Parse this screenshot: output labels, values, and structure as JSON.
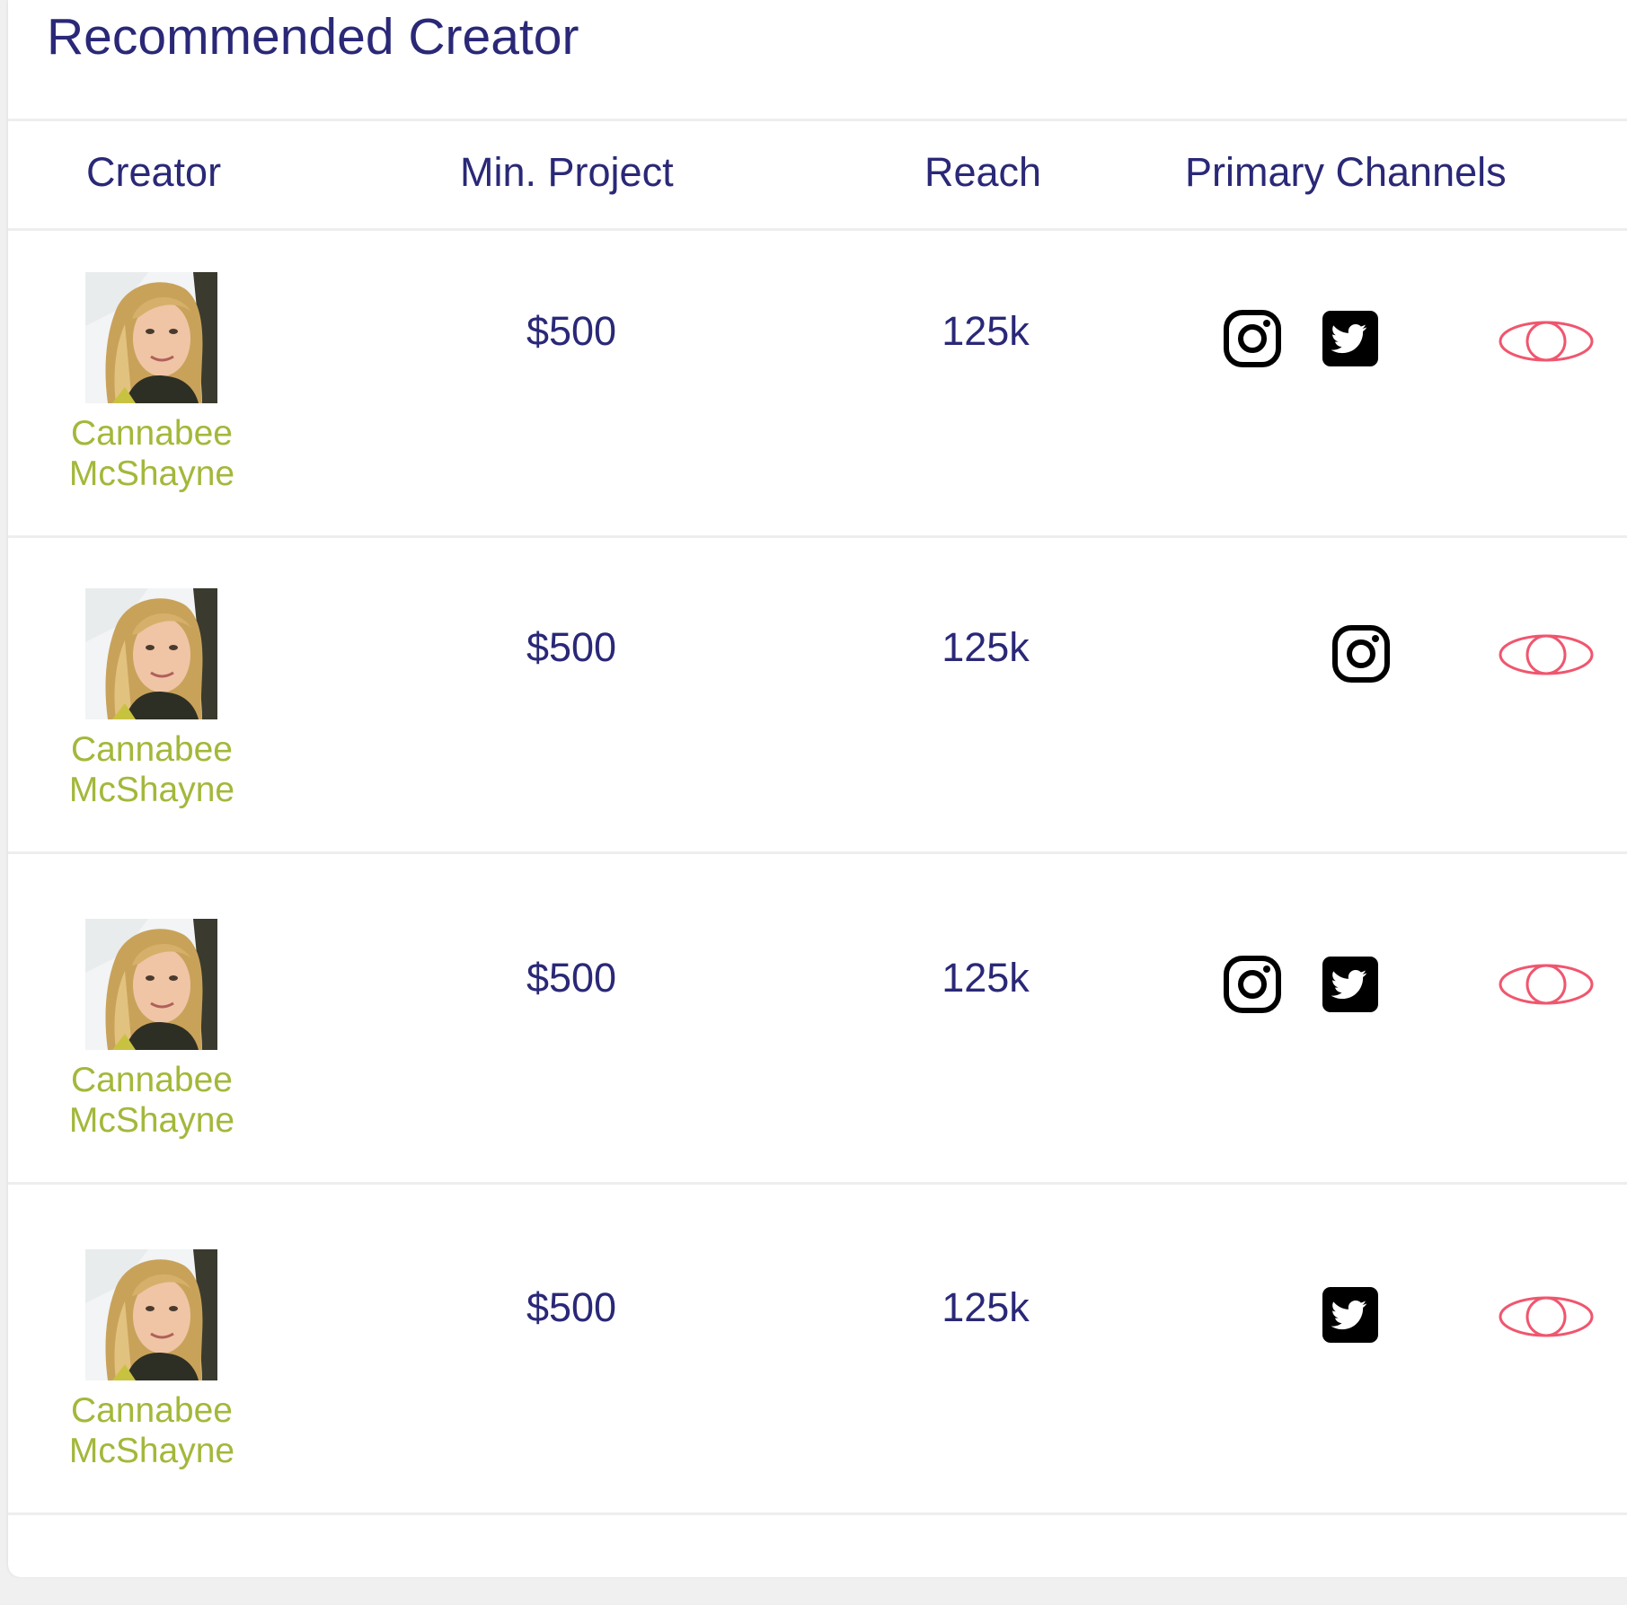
{
  "title": "Recommended Creator",
  "columns": {
    "creator": "Creator",
    "min_project": "Min. Project",
    "reach": "Reach",
    "channels": "Primary Channels"
  },
  "rows": [
    {
      "name_first": "Cannabee",
      "name_last": "McShayne",
      "min_project": "$500",
      "reach": "125k",
      "channels": [
        "instagram",
        "twitter"
      ]
    },
    {
      "name_first": "Cannabee",
      "name_last": "McShayne",
      "min_project": "$500",
      "reach": "125k",
      "channels": [
        "instagram"
      ]
    },
    {
      "name_first": "Cannabee",
      "name_last": "McShayne",
      "min_project": "$500",
      "reach": "125k",
      "channels": [
        "instagram",
        "twitter"
      ]
    },
    {
      "name_first": "Cannabee",
      "name_last": "McShayne",
      "min_project": "$500",
      "reach": "125k",
      "channels": [
        "twitter"
      ]
    }
  ],
  "icons": {
    "instagram": "instagram-icon",
    "twitter": "twitter-icon",
    "view": "eye-icon"
  },
  "colors": {
    "heading": "#2a2877",
    "creator_name": "#a3b83a",
    "eye_accent": "#f0566e",
    "divider": "#eeeeee"
  }
}
